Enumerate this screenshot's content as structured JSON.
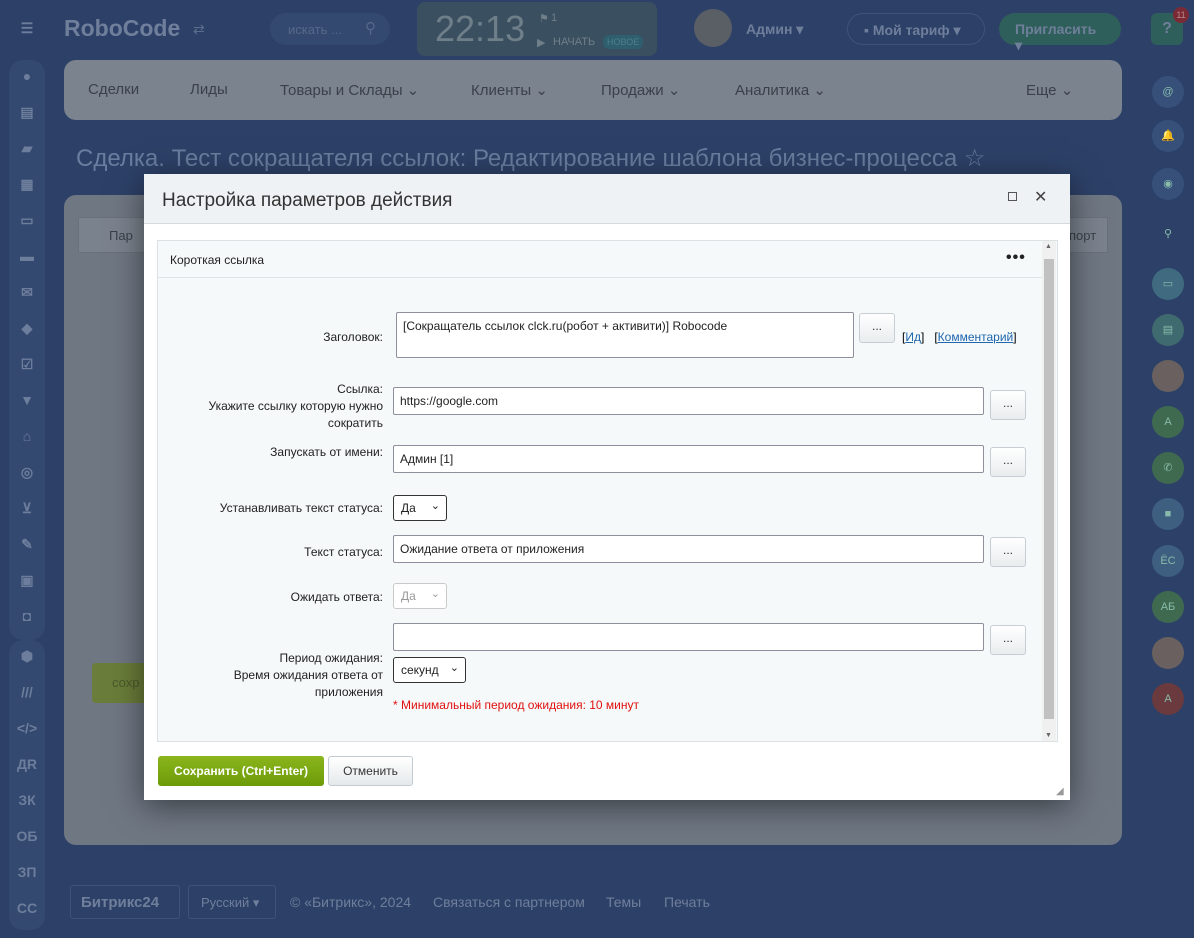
{
  "header": {
    "logo": "RoboCode",
    "search_placeholder": "искать ...",
    "clock": "22:13",
    "flag_count": "1",
    "start_label": "НАЧАТЬ",
    "new_badge": "НОВОЕ",
    "user": "Админ",
    "tariff": "Мой тариф",
    "invite": "Пригласить",
    "help_badge": "11"
  },
  "menu": [
    "Сделки",
    "Лиды",
    "Товары и Склады",
    "Клиенты",
    "Продажи",
    "Аналитика",
    "Еще"
  ],
  "page_title": "Сделка. Тест сокращателя ссылок: Редактирование шаблона бизнес-процесса ☆",
  "background": {
    "left_button": "Пар",
    "right_button": "порт",
    "save_button": "сохр"
  },
  "leftbar": {
    "text_items": [
      "ДR",
      "ЗК",
      "ОБ",
      "ЗП",
      "СС"
    ]
  },
  "rightbar": {
    "initials": [
      "А",
      "ЁС",
      "АБ",
      "А"
    ]
  },
  "footer": {
    "logo": "Битрикс24",
    "language": "Русский",
    "copyright": "© «Битрикс», 2024",
    "partner": "Связаться с партнером",
    "themes": "Темы",
    "print": "Печать"
  },
  "modal": {
    "title": "Настройка параметров действия",
    "panel_title": "Короткая ссылка",
    "fields": {
      "title_label": "Заголовок:",
      "title_value": "[Сокращатель ссылок clck.ru(робот + активити)] Robocode",
      "id_link": "Ид",
      "comment_link": "Комментарий",
      "link_label": "Ссылка:",
      "link_hint": "Укажите ссылку которую нужно сократить",
      "link_value": "https://google.com",
      "run_as_label": "Запускать от имени:",
      "run_as_value": "Админ [1]",
      "set_status_label": "Устанавливать текст статуса:",
      "set_status_value": "Да",
      "status_text_label": "Текст статуса:",
      "status_text_value": "Ожидание ответа от приложения",
      "wait_label": "Ожидать ответа:",
      "wait_value": "Да",
      "period_label": "Период ожидания:",
      "period_hint": "Время ожидания ответа от приложения",
      "period_value": "",
      "period_unit": "секунд",
      "period_note": "* Минимальный период ожидания: 10 минут"
    },
    "dots": "...",
    "save": "Сохранить (Ctrl+Enter)",
    "cancel": "Отменить"
  }
}
